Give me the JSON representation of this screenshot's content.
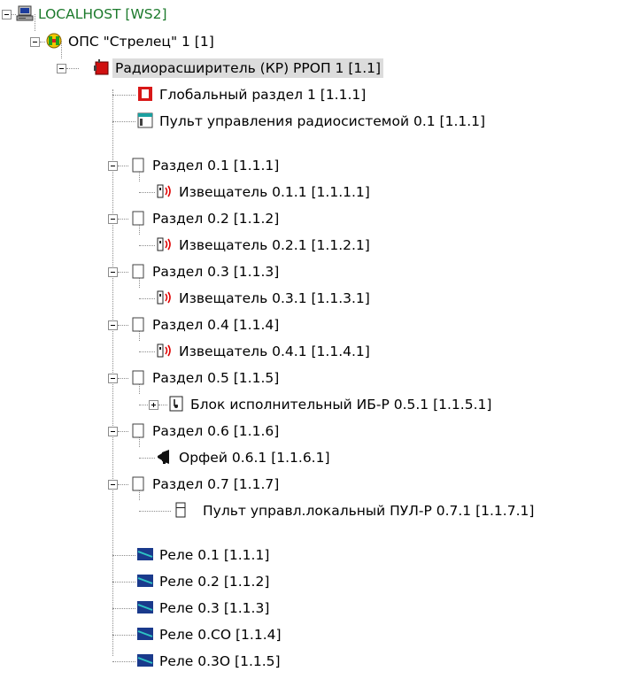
{
  "tree": {
    "root": {
      "label": "LOCALHOST [WS2]",
      "icon": "computer-icon"
    },
    "ops": {
      "label": "ОПС \"Стрелец\" 1 [1]",
      "icon": "strelets-panel-icon"
    },
    "expander": {
      "label": "Радиорасширитель (КР) РРОП 1 [1.1]",
      "icon": "radio-expander-icon"
    },
    "global_section": {
      "label": "Глобальный раздел 1 [1.1.1]",
      "icon": "global-section-icon"
    },
    "control_panel": {
      "label": "Пульт управления радиосистемой 0.1 [1.1.1]",
      "icon": "control-panel-icon"
    },
    "sections": [
      {
        "label": "Раздел 0.1 [1.1.1]",
        "child": "Извещатель 0.1.1 [1.1.1.1]",
        "child_icon": "detector-icon"
      },
      {
        "label": "Раздел 0.2 [1.1.2]",
        "child": "Извещатель 0.2.1 [1.1.2.1]",
        "child_icon": "detector-icon"
      },
      {
        "label": "Раздел 0.3 [1.1.3]",
        "child": "Извещатель 0.3.1 [1.1.3.1]",
        "child_icon": "detector-icon"
      },
      {
        "label": "Раздел 0.4 [1.1.4]",
        "child": "Извещатель 0.4.1 [1.1.4.1]",
        "child_icon": "detector-icon"
      },
      {
        "label": "Раздел 0.5 [1.1.5]",
        "child": "Блок исполнительный ИБ-Р 0.5.1 [1.1.5.1]",
        "child_icon": "actuator-block-icon"
      },
      {
        "label": "Раздел 0.6 [1.1.6]",
        "child": "Орфей 0.6.1 [1.1.6.1]",
        "child_icon": "siren-icon"
      },
      {
        "label": "Раздел 0.7 [1.1.7]",
        "child": "Пульт управл.локальный ПУЛ-Р 0.7.1 [1.1.7.1]",
        "child_icon": "local-panel-icon"
      }
    ],
    "relays": [
      {
        "label": "Реле 0.1 [1.1.1]"
      },
      {
        "label": "Реле 0.2 [1.1.2]"
      },
      {
        "label": "Реле 0.3 [1.1.3]"
      },
      {
        "label": "Реле 0.CO [1.1.4]"
      },
      {
        "label": "Реле 0.3O [1.1.5]"
      }
    ],
    "colors": {
      "host_text": "#1c7a2c",
      "selection": "#dcdcdc",
      "relay_icon": "#1a3a8c",
      "relay_stripe": "#2ec4c4",
      "detector_red": "#e00000"
    }
  }
}
